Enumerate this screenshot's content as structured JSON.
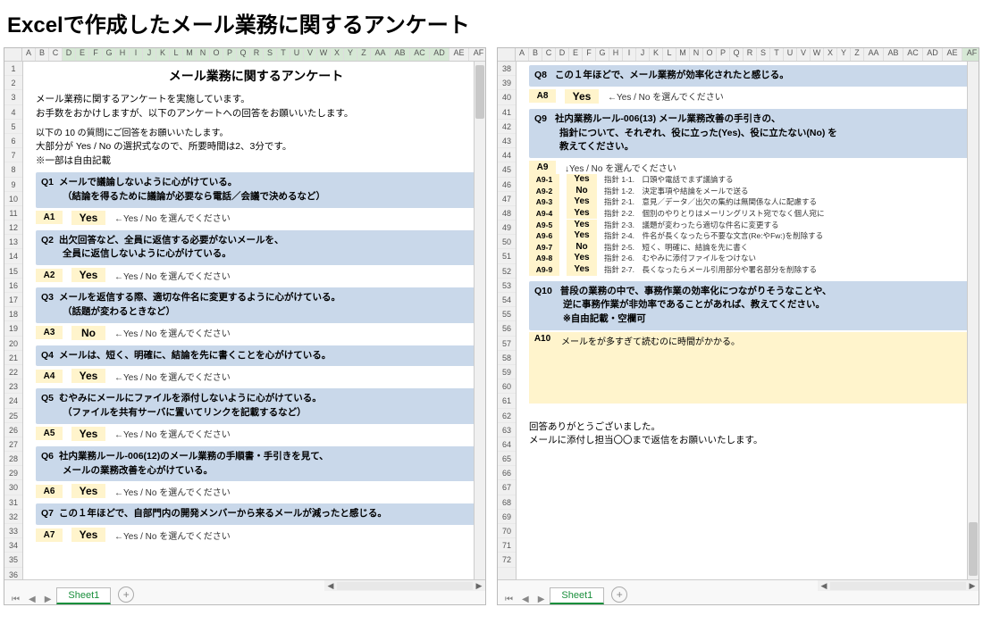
{
  "page_title": "Excelで作成したメール業務に関するアンケート",
  "sheet_tab": "Sheet1",
  "column_letters": [
    "A",
    "B",
    "C",
    "D",
    "E",
    "F",
    "G",
    "H",
    "I",
    "J",
    "K",
    "L",
    "M",
    "N",
    "O",
    "P",
    "Q",
    "R",
    "S",
    "T",
    "U",
    "V",
    "W",
    "X",
    "Y",
    "Z",
    "AA",
    "AB",
    "AC",
    "AD",
    "AE",
    "AF"
  ],
  "left": {
    "row_start": 1,
    "row_end": 38,
    "selected_cols_from": 4,
    "selected_cols_to": 30,
    "title": "メール業務に関するアンケート",
    "intro": [
      "メール業務に関するアンケートを実施しています。",
      "お手数をおかけしますが、以下のアンケートへの回答をお願いいたします。"
    ],
    "intro_note": [
      "以下の 10 の質問にご回答をお願いいたします。",
      "大部分が Yes / No の選択式なので、所要時間は2、3分です。",
      "※一部は自由記載"
    ],
    "questions": [
      {
        "qnum": "Q1",
        "lines": [
          "メールで議論しないように心がけている。",
          "（結論を得るために議論が必要なら電話／会議で決めるなど）"
        ],
        "anum": "A1",
        "avalue": "Yes",
        "hint": "←Yes / No を選んでください"
      },
      {
        "qnum": "Q2",
        "lines": [
          "出欠回答など、全員に返信する必要がないメールを、",
          "全員に返信しないように心がけている。"
        ],
        "anum": "A2",
        "avalue": "Yes",
        "hint": "←Yes / No を選んでください"
      },
      {
        "qnum": "Q3",
        "lines": [
          "メールを返信する際、適切な件名に変更するように心がけている。",
          "（話題が変わるときなど）"
        ],
        "anum": "A3",
        "avalue": "No",
        "hint": "←Yes / No を選んでください"
      },
      {
        "qnum": "Q4",
        "lines": [
          "メールは、短く、明確に、結論を先に書くことを心がけている。"
        ],
        "anum": "A4",
        "avalue": "Yes",
        "hint": "←Yes / No を選んでください"
      },
      {
        "qnum": "Q5",
        "lines": [
          "むやみにメールにファイルを添付しないように心がけている。",
          "（ファイルを共有サーバに置いてリンクを記載するなど）"
        ],
        "anum": "A5",
        "avalue": "Yes",
        "hint": "←Yes / No を選んでください"
      },
      {
        "qnum": "Q6",
        "lines": [
          "社内業務ルール-006(12)のメール業務の手順書・手引きを見て、",
          "メールの業務改善を心がけている。"
        ],
        "anum": "A6",
        "avalue": "Yes",
        "hint": "←Yes / No を選んでください"
      },
      {
        "qnum": "Q7",
        "lines": [
          "この１年ほどで、自部門内の開発メンバーから来るメールが減ったと感じる。"
        ],
        "anum": "A7",
        "avalue": "Yes",
        "hint": "←Yes / No を選んでください"
      }
    ]
  },
  "right": {
    "row_start": 38,
    "row_end": 72,
    "selected_col": 32,
    "q8": {
      "qnum": "Q8",
      "line": "この１年ほどで、メール業務が効率化されたと感じる。",
      "anum": "A8",
      "avalue": "Yes",
      "hint": "←Yes / No を選んでください"
    },
    "q9": {
      "qnum": "Q9",
      "lines": [
        "社内業務ルール-006(13) メール業務改善の手引きの、",
        "指針について、それぞれ、役に立った(Yes)、役に立たない(No) を",
        "教えてください。"
      ],
      "anum": "A9",
      "hint": "↓Yes / No を選んでください",
      "sub": [
        {
          "label": "A9-1",
          "value": "Yes",
          "desc": "指針 1-1.　口頭や電話でまず議論する"
        },
        {
          "label": "A9-2",
          "value": "No",
          "desc": "指針 1-2.　決定事項や結論をメールで送る"
        },
        {
          "label": "A9-3",
          "value": "Yes",
          "desc": "指針 2-1.　意見／データ／出欠の集約は無関係な人に配慮する"
        },
        {
          "label": "A9-4",
          "value": "Yes",
          "desc": "指針 2-2.　個別のやりとりはメーリングリスト宛でなく個人宛に"
        },
        {
          "label": "A9-5",
          "value": "Yes",
          "desc": "指針 2-3.　議題が変わったら適切な件名に変更する"
        },
        {
          "label": "A9-6",
          "value": "Yes",
          "desc": "指針 2-4.　件名が長くなったら不要な文言(Re:やFw:)を削除する"
        },
        {
          "label": "A9-7",
          "value": "No",
          "desc": "指針 2-5.　短く、明確に、結論を先に書く"
        },
        {
          "label": "A9-8",
          "value": "Yes",
          "desc": "指針 2-6.　むやみに添付ファイルをつけない"
        },
        {
          "label": "A9-9",
          "value": "Yes",
          "desc": "指針 2-7.　長くなったらメール引用部分や署名部分を削除する"
        }
      ]
    },
    "q10": {
      "qnum": "Q10",
      "lines": [
        "普段の業務の中で、事務作業の効率化につながりそうなことや、",
        "逆に事務作業が非効率であることがあれば、教えてください。",
        "※自由記載・空欄可"
      ],
      "anum": "A10",
      "atext": "メールをが多すぎて読むのに時間がかかる。"
    },
    "thanks": [
      "回答ありがとうございました。",
      "メールに添付し担当〇〇まで返信をお願いいたします。"
    ]
  }
}
